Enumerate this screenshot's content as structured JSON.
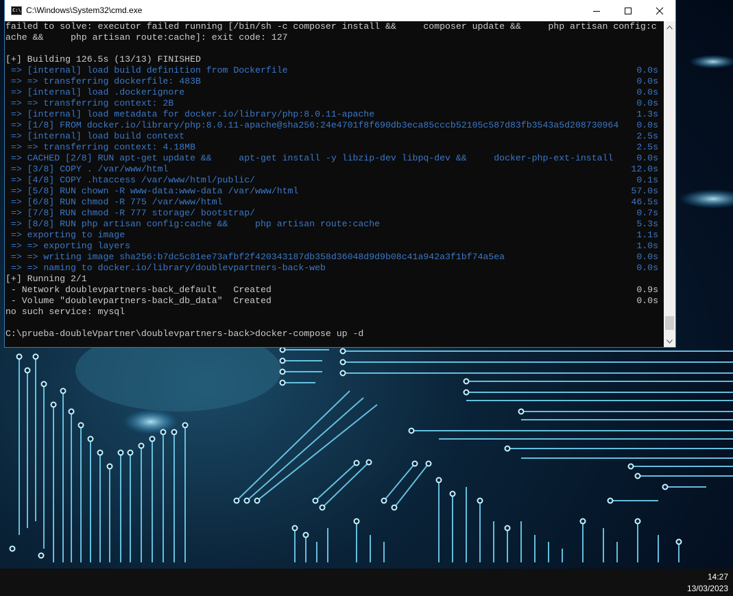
{
  "window": {
    "title": "C:\\Windows\\System32\\cmd.exe",
    "icon_label": "C:\\",
    "controls": [
      "minimize-icon",
      "maximize-icon",
      "close-icon"
    ]
  },
  "console": {
    "lines": [
      {
        "text": "failed to solve: executor failed running [/bin/sh -c composer install &&     composer update &&     php artisan config:c",
        "color": "white"
      },
      {
        "text": "ache &&     php artisan route:cache]: exit code: 127",
        "color": "white"
      },
      {
        "text": "",
        "color": "white"
      },
      {
        "text": "[+] Building 126.5s (13/13) FINISHED",
        "color": "white"
      },
      {
        "text": " => [internal] load build definition from Dockerfile",
        "color": "blue",
        "time": "0.0s"
      },
      {
        "text": " => => transferring dockerfile: 483B",
        "color": "blue",
        "time": "0.0s"
      },
      {
        "text": " => [internal] load .dockerignore",
        "color": "blue",
        "time": "0.0s"
      },
      {
        "text": " => => transferring context: 2B",
        "color": "blue",
        "time": "0.0s"
      },
      {
        "text": " => [internal] load metadata for docker.io/library/php:8.0.11-apache",
        "color": "blue",
        "time": "1.3s"
      },
      {
        "text": " => [1/8] FROM docker.io/library/php:8.0.11-apache@sha256:24e4701f8f690db3eca85cccb52105c587d83fb3543a5d208730964",
        "color": "blue",
        "time": "0.0s"
      },
      {
        "text": " => [internal] load build context",
        "color": "blue",
        "time": "2.5s"
      },
      {
        "text": " => => transferring context: 4.18MB",
        "color": "blue",
        "time": "2.5s"
      },
      {
        "text": " => CACHED [2/8] RUN apt-get update &&     apt-get install -y libzip-dev libpq-dev &&     docker-php-ext-install",
        "color": "blue",
        "time": "0.0s"
      },
      {
        "text": " => [3/8] COPY . /var/www/html",
        "color": "blue",
        "time": "12.0s"
      },
      {
        "text": " => [4/8] COPY .htaccess /var/www/html/public/",
        "color": "blue",
        "time": "0.1s"
      },
      {
        "text": " => [5/8] RUN chown -R www-data:www-data /var/www/html",
        "color": "blue",
        "time": "57.0s"
      },
      {
        "text": " => [6/8] RUN chmod -R 775 /var/www/html",
        "color": "blue",
        "time": "46.5s"
      },
      {
        "text": " => [7/8] RUN chmod -R 777 storage/ bootstrap/",
        "color": "blue",
        "time": "0.7s"
      },
      {
        "text": " => [8/8] RUN php artisan config:cache &&     php artisan route:cache",
        "color": "blue",
        "time": "5.3s"
      },
      {
        "text": " => exporting to image",
        "color": "blue",
        "time": "1.1s"
      },
      {
        "text": " => => exporting layers",
        "color": "blue",
        "time": "1.0s"
      },
      {
        "text": " => => writing image sha256:b7dc5c81ee73afbf2f420343187db358d36048d9d9b08c41a942a3f1bf74a5ea",
        "color": "blue",
        "time": "0.0s"
      },
      {
        "text": " => => naming to docker.io/library/doublevpartners-back-web",
        "color": "blue",
        "time": "0.0s"
      },
      {
        "text": "[+] Running 2/1",
        "color": "white"
      },
      {
        "text": " - Network doublevpartners-back_default   Created",
        "color": "white",
        "time": "0.9s"
      },
      {
        "text": " - Volume \"doublevpartners-back_db_data\"  Created",
        "color": "white",
        "time": "0.0s"
      },
      {
        "text": "no such service: mysql",
        "color": "white"
      },
      {
        "text": "",
        "color": "white"
      },
      {
        "text": "C:\\prueba-doubleVpartner\\doublevpartners-back>docker-compose up -d",
        "color": "white"
      }
    ]
  },
  "colors": {
    "console_bg": "#0c0c0c",
    "console_text": "#cccccc",
    "console_blue": "#3b78c8",
    "titlebar_bg": "#ffffff",
    "taskbar_bg": "#101010"
  },
  "taskbar": {
    "time": "14:27",
    "date": "13/03/2023"
  }
}
